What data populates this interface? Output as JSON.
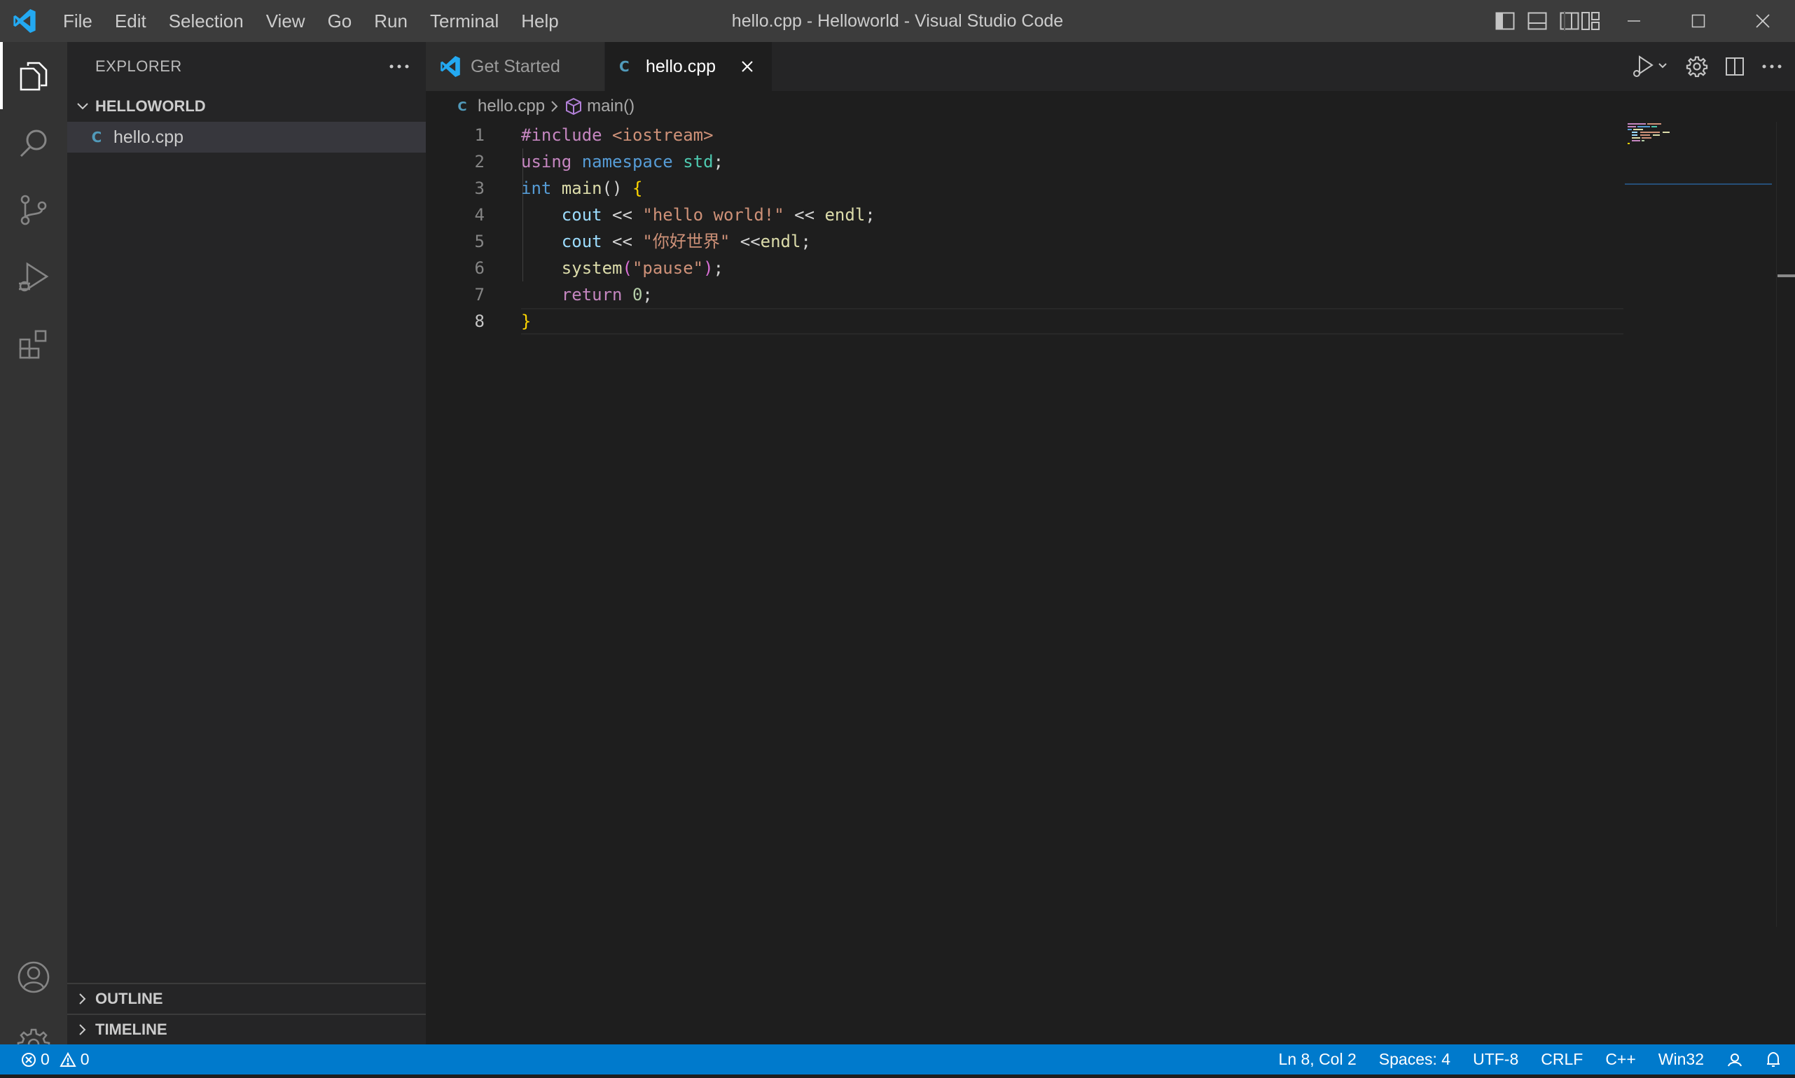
{
  "window": {
    "title": "hello.cpp - Helloworld - Visual Studio Code",
    "menu": [
      "File",
      "Edit",
      "Selection",
      "View",
      "Go",
      "Run",
      "Terminal",
      "Help"
    ]
  },
  "activity_bar": {
    "items": [
      "explorer",
      "search",
      "source-control",
      "run-and-debug",
      "extensions"
    ],
    "bottom_items": [
      "accounts",
      "manage"
    ]
  },
  "sidebar": {
    "title": "EXPLORER",
    "folder": "HELLOWORLD",
    "files": [
      {
        "name": "hello.cpp",
        "icon": "cpp-icon"
      }
    ],
    "outline": "OUTLINE",
    "timeline": "TIMELINE"
  },
  "tabs": [
    {
      "label": "Get Started",
      "icon": "vscode-logo-icon",
      "active": false
    },
    {
      "label": "hello.cpp",
      "icon": "cpp-icon",
      "active": true
    }
  ],
  "breadcrumb": {
    "file": "hello.cpp",
    "symbol": "main()"
  },
  "editor": {
    "current_line": 8,
    "lines": [
      {
        "n": "1",
        "segments": [
          [
            "k-dir",
            "#include "
          ],
          [
            "k-inc",
            "<iostream>"
          ]
        ]
      },
      {
        "n": "2",
        "segments": [
          [
            "k-ctl",
            "using "
          ],
          [
            "k-kw",
            "namespace "
          ],
          [
            "k-ns",
            "std"
          ],
          [
            "k-op",
            ";"
          ]
        ]
      },
      {
        "n": "3",
        "segments": [
          [
            "k-kw",
            "int "
          ],
          [
            "k-fn",
            "main"
          ],
          [
            "k-op",
            "() "
          ],
          [
            "k-br1",
            "{"
          ]
        ]
      },
      {
        "n": "4",
        "segments": [
          [
            "k-op",
            "    "
          ],
          [
            "k-var",
            "cout"
          ],
          [
            "k-op",
            " << "
          ],
          [
            "k-str",
            "\"hello world!\""
          ],
          [
            "k-op",
            " << "
          ],
          [
            "k-fn",
            "endl"
          ],
          [
            "k-op",
            ";"
          ]
        ]
      },
      {
        "n": "5",
        "segments": [
          [
            "k-op",
            "    "
          ],
          [
            "k-var",
            "cout"
          ],
          [
            "k-op",
            " << "
          ],
          [
            "k-str",
            "\"你好世界\""
          ],
          [
            "k-op",
            " <<"
          ],
          [
            "k-fn",
            "endl"
          ],
          [
            "k-op",
            ";"
          ]
        ]
      },
      {
        "n": "6",
        "segments": [
          [
            "k-op",
            "    "
          ],
          [
            "k-fn",
            "system"
          ],
          [
            "k-br2",
            "("
          ],
          [
            "k-str",
            "\"pause\""
          ],
          [
            "k-br2",
            ")"
          ],
          [
            "k-op",
            ";"
          ]
        ]
      },
      {
        "n": "7",
        "segments": [
          [
            "k-op",
            "    "
          ],
          [
            "k-ctl",
            "return "
          ],
          [
            "k-num",
            "0"
          ],
          [
            "k-op",
            ";"
          ]
        ]
      },
      {
        "n": "8",
        "segments": [
          [
            "k-br1",
            "}"
          ]
        ]
      }
    ]
  },
  "status_bar": {
    "errors": "0",
    "warnings": "0",
    "position": "Ln 8, Col 2",
    "spaces": "Spaces: 4",
    "encoding": "UTF-8",
    "eol": "CRLF",
    "language": "C++",
    "platform": "Win32"
  },
  "colors": {
    "accent": "#007acc",
    "cpp_icon": "#519aba",
    "vscode_logo": "#23a9f2"
  }
}
